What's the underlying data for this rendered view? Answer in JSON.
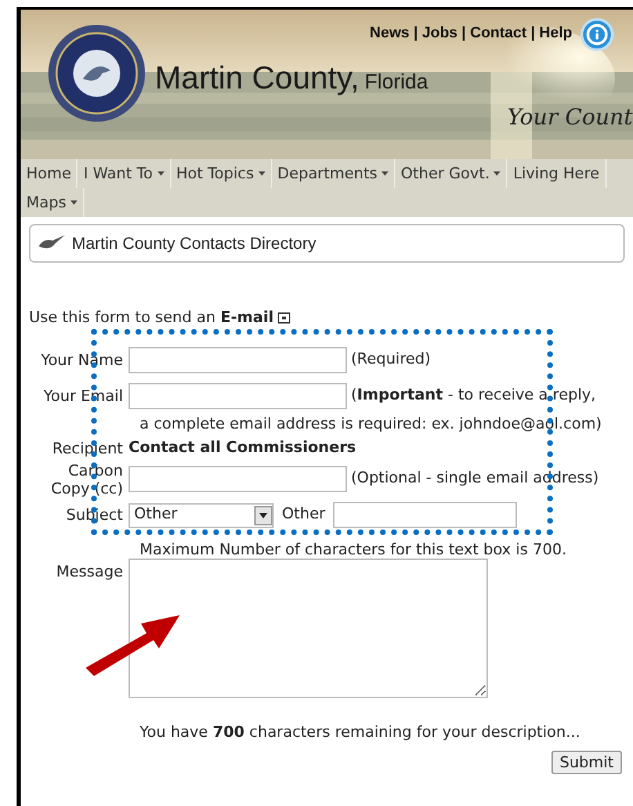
{
  "header": {
    "links": [
      "News",
      "Jobs",
      "Contact",
      "Help"
    ],
    "separator": "|",
    "title": "Martin County,",
    "subtitle": "Florida",
    "tagline": "Your Count"
  },
  "nav": [
    {
      "label": "Home",
      "dropdown": false
    },
    {
      "label": "I Want To",
      "dropdown": true
    },
    {
      "label": "Hot Topics",
      "dropdown": true
    },
    {
      "label": "Departments",
      "dropdown": true
    },
    {
      "label": "Other Govt.",
      "dropdown": true
    },
    {
      "label": "Living Here",
      "dropdown": false
    },
    {
      "label": "Maps",
      "dropdown": true
    }
  ],
  "breadcrumb": "Martin County Contacts Directory",
  "form": {
    "intro": "Use this form to send an **E-mail**",
    "rows": [
      {
        "kind": "input",
        "label": "Your Name",
        "note": "(Required)"
      },
      {
        "kind": "input",
        "label": "Your Email",
        "note": "(**Important** - to receive a reply,",
        "note_line2": "a complete email address is required: ex. johndoe@aol.com)"
      },
      {
        "kind": "text",
        "label": "Recipient",
        "value": "Contact all Commissioners"
      },
      {
        "kind": "input",
        "label": "Carbon Copy (cc)",
        "note": "(Optional - single email address)"
      },
      {
        "kind": "select",
        "label": "Subject",
        "value": "Other",
        "other_label": "Other"
      }
    ],
    "max_note": "Maximum Number of characters for this text box is 700.",
    "message_label": "Message",
    "remaining": "You have **700** characters remaining for your description...",
    "submit": "Submit"
  }
}
